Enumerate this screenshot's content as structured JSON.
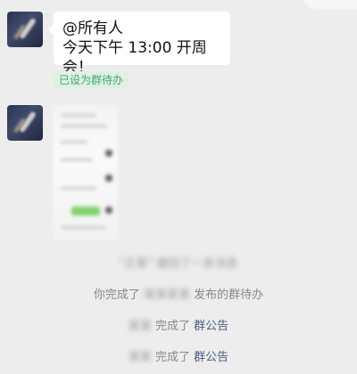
{
  "chat": {
    "mention_line": "@所有人",
    "message_line": "今天下午 13:00 开周会！",
    "todo_tag": "已设为群待办"
  },
  "system_messages": {
    "line1_blurred": "\"王某\" 撤回了一条消息",
    "line2_prefix": "你完成了",
    "line2_blurred": "某某某某",
    "line2_suffix": "发布的群待办",
    "line3_blurred": "某某",
    "line3_mid": "完成了",
    "line3_link": "群公告",
    "line4_blurred": "某某",
    "line4_mid": "完成了",
    "line4_link": "群公告"
  },
  "colors": {
    "background": "#ededed",
    "bubble": "#ffffff",
    "tag_bg": "#dff0e4",
    "tag_text": "#3fa96b",
    "link": "#4a5b82"
  }
}
